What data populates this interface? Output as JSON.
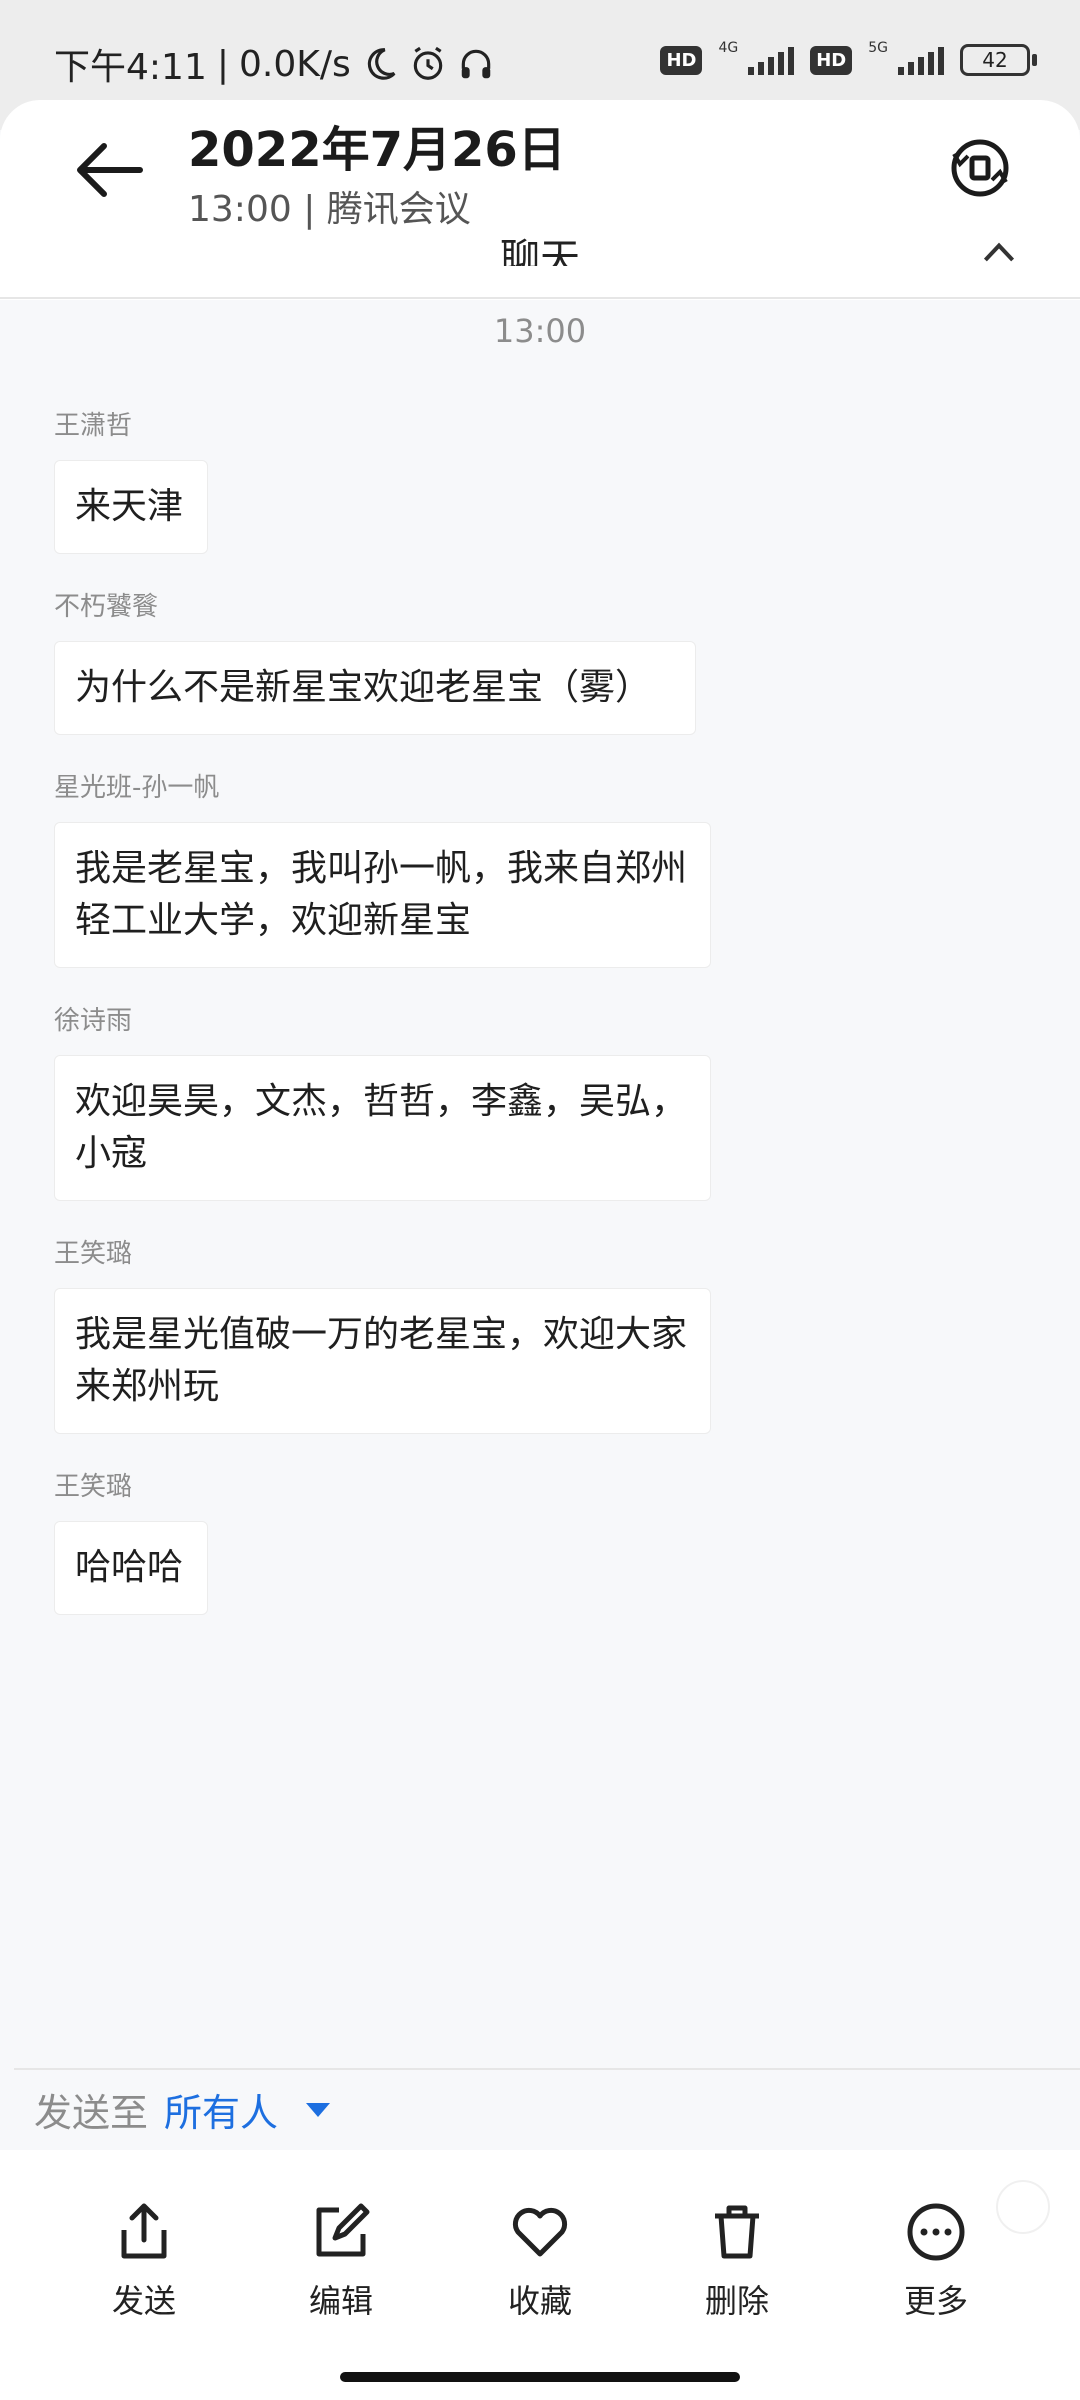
{
  "status_bar": {
    "time": "下午4:11",
    "speed": "0.0K/s",
    "hd1": "HD",
    "net1": "4G",
    "hd2": "HD",
    "net2": "5G",
    "battery": "42"
  },
  "header": {
    "title": "2022年7月26日",
    "subtitle": "13:00 | 腾讯会议",
    "chat_title": "聊天"
  },
  "chat": {
    "timestamp": "13:00",
    "messages": [
      {
        "sender": "王潇哲",
        "text": "来天津"
      },
      {
        "sender": "不朽饕餮",
        "text": "为什么不是新星宝欢迎老星宝（雾）"
      },
      {
        "sender": "星光班-孙一帆",
        "text": "我是老星宝，我叫孙一帆，我来自郑州轻工业大学，欢迎新星宝"
      },
      {
        "sender": "徐诗雨",
        "text": "欢迎昊昊，文杰，哲哲，李鑫，吴弘，小寇"
      },
      {
        "sender": "王笑璐",
        "text": "我是星光值破一万的老星宝，欢迎大家来郑州玩"
      },
      {
        "sender": "王笑璐",
        "text": "哈哈哈"
      }
    ]
  },
  "send_to": {
    "label": "发送至",
    "target": "所有人"
  },
  "toolbar": {
    "send": "发送",
    "edit": "编辑",
    "favorite": "收藏",
    "delete": "删除",
    "more": "更多"
  },
  "colors": {
    "accent": "#1d6fe0",
    "background": "#f7f8fa"
  }
}
